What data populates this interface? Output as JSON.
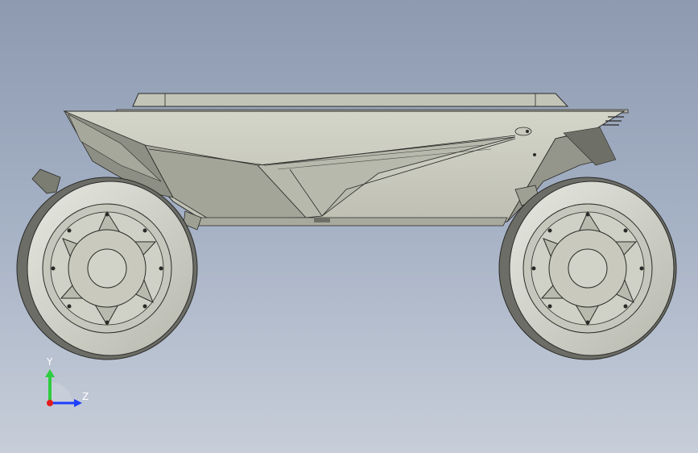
{
  "viewport": {
    "background_top": "#8d9ab0",
    "background_bottom": "#c7ced9"
  },
  "model": {
    "body_color": "#c9cabd",
    "body_shadow": "#8e8f84",
    "tire_color": "#d4d5cc",
    "edge_color": "#2a2a28"
  },
  "triad": {
    "y_label": "Y",
    "z_label": "Z",
    "y_color": "#2ecc40",
    "z_color": "#1e3fff",
    "x_color": "#e31b1b"
  }
}
